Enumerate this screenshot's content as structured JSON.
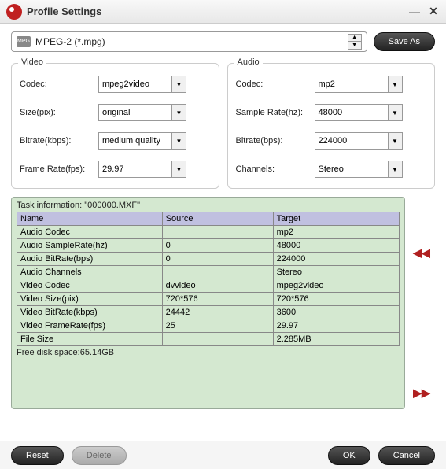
{
  "window": {
    "title": "Profile Settings"
  },
  "profile": {
    "label": "MPEG-2 (*.mpg)",
    "icon_text": "MPG"
  },
  "buttons": {
    "save_as": "Save As",
    "reset": "Reset",
    "delete": "Delete",
    "ok": "OK",
    "cancel": "Cancel"
  },
  "video_panel": {
    "title": "Video",
    "codec_label": "Codec:",
    "codec_value": "mpeg2video",
    "size_label": "Size(pix):",
    "size_value": "original",
    "bitrate_label": "Bitrate(kbps):",
    "bitrate_value": "medium quality",
    "framerate_label": "Frame Rate(fps):",
    "framerate_value": "29.97"
  },
  "audio_panel": {
    "title": "Audio",
    "codec_label": "Codec:",
    "codec_value": "mp2",
    "samplerate_label": "Sample Rate(hz):",
    "samplerate_value": "48000",
    "bitrate_label": "Bitrate(bps):",
    "bitrate_value": "224000",
    "channels_label": "Channels:",
    "channels_value": "Stereo"
  },
  "task": {
    "title": "Task information: \"000000.MXF\"",
    "headers": {
      "name": "Name",
      "source": "Source",
      "target": "Target"
    },
    "rows": [
      {
        "name": "Audio Codec",
        "source": "",
        "target": "mp2"
      },
      {
        "name": "Audio SampleRate(hz)",
        "source": "0",
        "target": "48000"
      },
      {
        "name": "Audio BitRate(bps)",
        "source": "0",
        "target": "224000"
      },
      {
        "name": "Audio Channels",
        "source": "",
        "target": "Stereo"
      },
      {
        "name": "Video Codec",
        "source": "dvvideo",
        "target": "mpeg2video"
      },
      {
        "name": "Video Size(pix)",
        "source": "720*576",
        "target": "720*576"
      },
      {
        "name": "Video BitRate(kbps)",
        "source": "24442",
        "target": "3600"
      },
      {
        "name": "Video FrameRate(fps)",
        "source": "25",
        "target": "29.97"
      },
      {
        "name": "File Size",
        "source": "",
        "target": "2.285MB"
      }
    ],
    "free_space": "Free disk space:65.14GB"
  }
}
